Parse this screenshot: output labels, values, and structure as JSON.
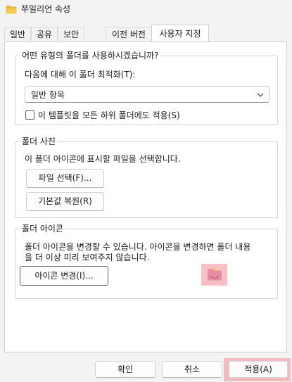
{
  "window": {
    "title": "쭈일리언 속성",
    "icon": "folder-icon"
  },
  "tabs": [
    {
      "label": "일반",
      "active": false
    },
    {
      "label": "공유",
      "active": false
    },
    {
      "label": "보안",
      "active": false
    },
    {
      "label": "이전 버전",
      "active": false
    },
    {
      "label": "사용자 지정",
      "active": true
    }
  ],
  "folder_type": {
    "group_title": "어떤 유형의 폴더를 사용하시겠습니까?",
    "optimize_label": "다음에 대해 이 폴더 최적화(T):",
    "selected_option": "일반 항목",
    "apply_template_label": "이 템플릿을 모든 하위 폴더에도 적용(S)",
    "apply_template_checked": false
  },
  "folder_pictures": {
    "group_title": "폴더 사진",
    "description": "이 폴더 아이콘에 표시할 파일을 선택합니다.",
    "choose_file_label": "파일 선택(F)...",
    "restore_default_label": "기본값 복원(R)"
  },
  "folder_icon": {
    "group_title": "폴더 아이콘",
    "description_line1": "폴더 아이콘을 변경할 수 있습니다. 아이콘을 변경하면 폴더 내용",
    "description_line2": "을 더 이상  미리 보여주지 않습니다.",
    "change_icon_label": "아이콘 변경(I)...",
    "preview_icon": "pink-folder-icon"
  },
  "footer": {
    "ok_label": "확인",
    "cancel_label": "취소",
    "apply_label": "적용(A)"
  },
  "colors": {
    "highlight": "#f08c96",
    "folder_yellow": "#e8b23c",
    "preview_folder": "#e88aa4"
  }
}
